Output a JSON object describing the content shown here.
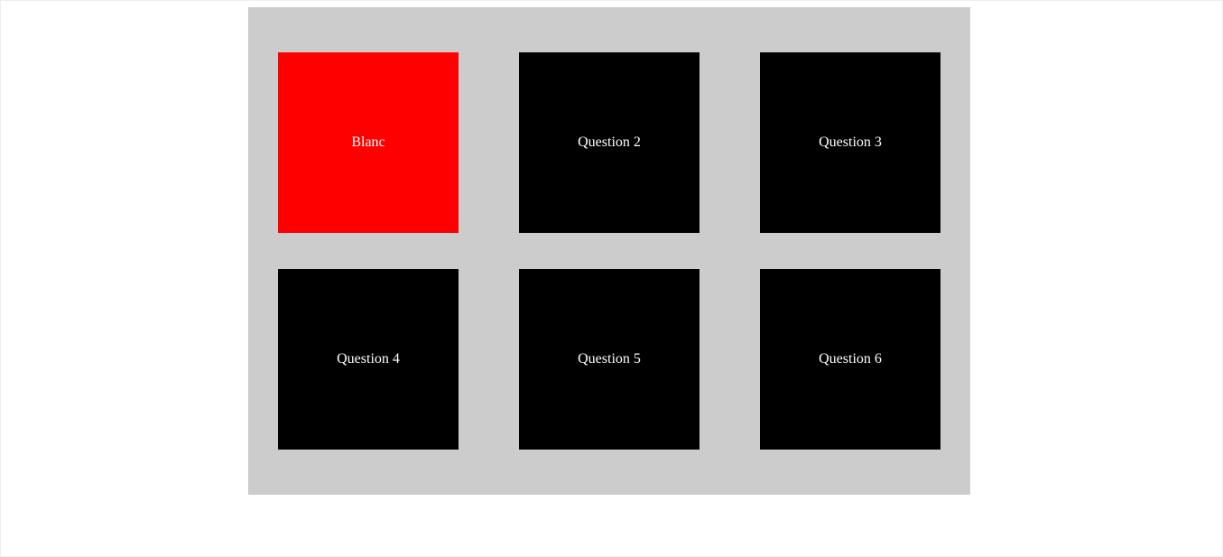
{
  "tiles": [
    {
      "label": "Blanc",
      "color": "#ff0000"
    },
    {
      "label": "Question 2",
      "color": "#000000"
    },
    {
      "label": "Question 3",
      "color": "#000000"
    },
    {
      "label": "Question 4",
      "color": "#000000"
    },
    {
      "label": "Question 5",
      "color": "#000000"
    },
    {
      "label": "Question 6",
      "color": "#000000"
    }
  ]
}
